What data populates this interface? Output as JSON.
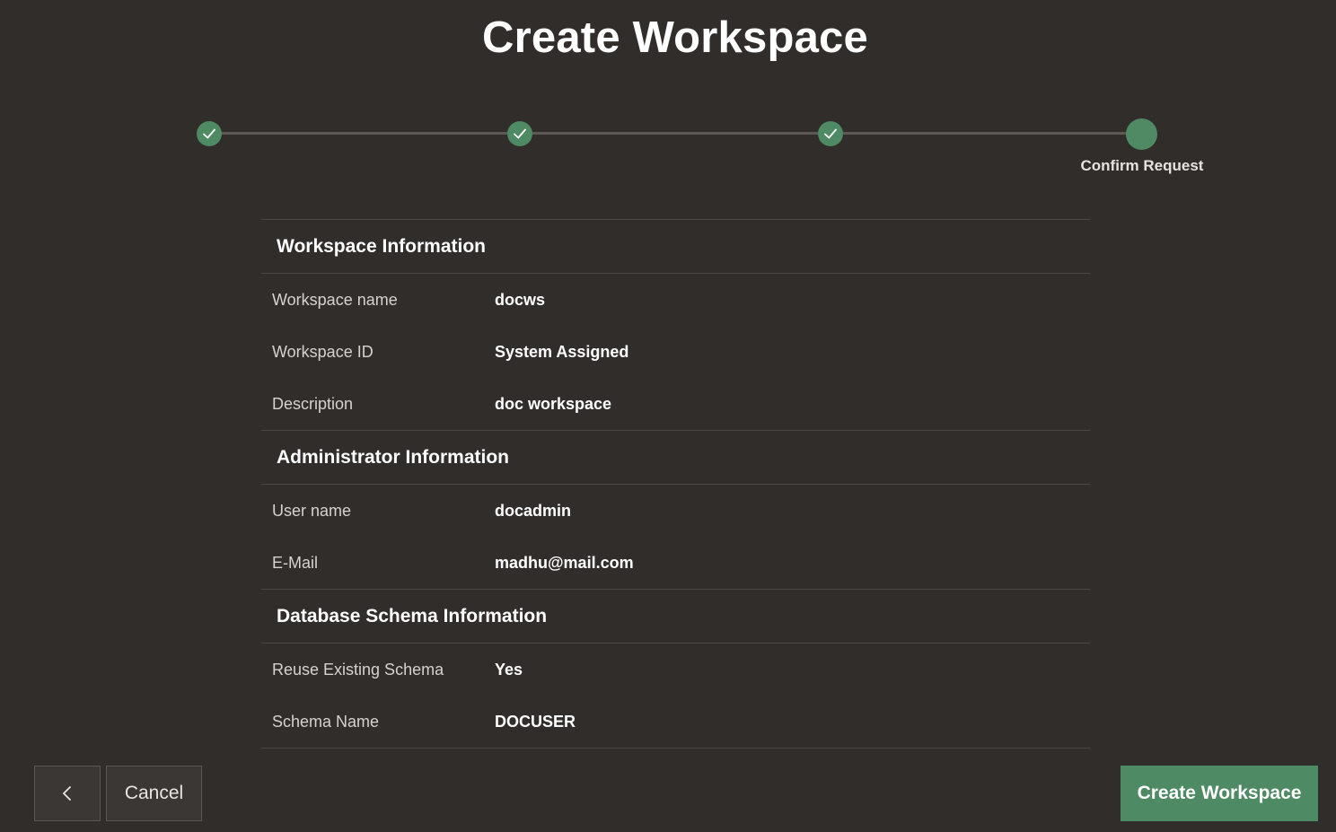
{
  "page": {
    "title": "Create Workspace"
  },
  "train": {
    "steps": [
      {
        "state": "complete",
        "label": ""
      },
      {
        "state": "complete",
        "label": ""
      },
      {
        "state": "complete",
        "label": ""
      },
      {
        "state": "current",
        "label": "Confirm Request"
      }
    ],
    "check_icon": "check-icon",
    "accent_color": "#4e8a64"
  },
  "sections": [
    {
      "header": "Workspace Information",
      "rows": [
        {
          "label": "Workspace name",
          "value": "docws"
        },
        {
          "label": "Workspace ID",
          "value": "System Assigned"
        },
        {
          "label": "Description",
          "value": "doc workspace"
        }
      ]
    },
    {
      "header": "Administrator Information",
      "rows": [
        {
          "label": "User name",
          "value": "docadmin"
        },
        {
          "label": "E-Mail",
          "value": "madhu@mail.com"
        }
      ]
    },
    {
      "header": "Database Schema Information",
      "rows": [
        {
          "label": "Reuse Existing Schema",
          "value": "Yes"
        },
        {
          "label": "Schema Name",
          "value": "DOCUSER"
        }
      ]
    }
  ],
  "footer": {
    "back_icon": "chevron-left-icon",
    "cancel_label": "Cancel",
    "create_label": "Create Workspace"
  }
}
